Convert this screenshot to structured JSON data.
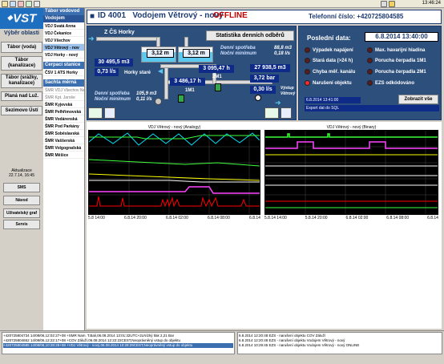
{
  "clock": "13:46:24",
  "logo": {
    "text": "VST"
  },
  "left_menu": {
    "title": "Výběr oblasti",
    "buttons": [
      "Tábor (voda)",
      "Tábor (kanalizace)",
      "Tábor (srážky, kanalizace)",
      "Planá nad Luž.",
      "Sezimovo Ústí"
    ],
    "aktualizace": "Aktualizace\n22.7.14, 16:45",
    "small_buttons": [
      "SMS",
      "Návod",
      "Uživatelský graf",
      "Servis"
    ]
  },
  "objects": {
    "group1": "Tábor vodovod",
    "group1b": "Vodojem",
    "items1": [
      "VDJ Svatá Anna",
      "VDJ Čekanice",
      "VDJ Všechov",
      "VDJ Větrový - nov",
      "VDJ Horky - nový"
    ],
    "group2": "Čerpací stanice",
    "items2": [
      "ČSV 1 ATS Horky"
    ],
    "group3": "Šachta měrná",
    "items3": [
      "ŠMR VDJ Všechov Ne",
      "ŠMR Kpt. Jaroše",
      "ŠMR Kyjevská",
      "ŠMR Pelhřimovská",
      "ŠMR Vodárenská",
      "ŠMR Pod Parkány",
      "ŠMR Soběslavská",
      "ŠMR Vaššerská",
      "ŠMR Volgogradská",
      "ŠMR Měšice"
    ]
  },
  "header": {
    "id": "ID 4001",
    "name": "Vodojem Větrový - nový",
    "status": "OFFLINE",
    "phone": "Telefonní číslo: +420725804585"
  },
  "schema": {
    "source": "Z ČS Horky",
    "stat_button": "Statistika denních odběrů",
    "tank1_level": "3,12 m",
    "tank2_level": "3,12 m",
    "spotreba_left_label": "Denní spotřeba\nNoční minimum",
    "spotreba_left_vals": "105,9 m3\n0,11 l/s",
    "spotreba_right_label": "Denní spotřeba\nNoční minimum",
    "spotreba_right_vals": "88,8 m3\n0,18 l/s",
    "v1": "30 495,5 m3",
    "v2": "0,73 l/s",
    "horky_stare": "Horky staré",
    "v3": "3 095,47 h",
    "v4": "3 486,17 h",
    "m1a": "2M1",
    "m1b": "1M1",
    "v5": "27 938,5 m3",
    "v6": "3,72 bar",
    "v7": "0,30 l/s",
    "vystup": "Výstup\nVětrový"
  },
  "right": {
    "posledni_label": "Poslední data:",
    "posledni_date": "6.8.2014 13:40:00",
    "alarms": [
      {
        "label": "Výpadek napájení",
        "active": false
      },
      {
        "label": "Max. havarijní hladina",
        "active": false
      },
      {
        "label": "Stará data (>24 h)",
        "active": false
      },
      {
        "label": "Porucha čerpadla 1M1",
        "active": false
      },
      {
        "label": "Chyba měř. kanálu",
        "active": false
      },
      {
        "label": "Porucha čerpadla 2M1",
        "active": false
      },
      {
        "label": "Narušení objektu",
        "active": true
      },
      {
        "label": "EZS odkódováno",
        "active": false
      }
    ],
    "export_date": "6.8.2014 13:41:00",
    "export_sql": "Export dat do SQL",
    "show_all": "Zobrazit vše"
  },
  "charts": {
    "analog_title": "VDJ Větrový - nový (Analogy)",
    "binary_title": "VDJ Větrový - nový (Binary)",
    "x_ticks": [
      "5.8 14:00",
      "6.8.14 20:00",
      "6.8.14 02:00",
      "6.8.14 08:00",
      "6.8.14"
    ],
    "x_ticks_bin": [
      "5.8.14 14:00",
      "5.8.14 20:00",
      "6.8.14 02:00",
      "6.8.14 08:00",
      "6.8.14"
    ],
    "y_ticks": [
      "4",
      "3",
      "2",
      "1",
      "0",
      "4",
      "3",
      "2",
      "1",
      "0"
    ],
    "colors": {
      "cyan": "#00e5ff",
      "green": "#3cff3c",
      "yellow": "#ffff00",
      "white": "#ffffff",
      "magenta": "#ff44ff",
      "red": "#ff0000"
    }
  },
  "log_left": [
    "+420725804734 14/08/06,12:02:27+08 +SMR Nam. T.Bali,06.08.2014 13:01:32UTC+2LNízký tlak 2,21 Bar",
    "+420725804652 14/08/06,12:22:17+08 +COV Záluží,06.08.2014 12:22:22CEST,Neoprávněný vstup do objektu",
    "+420725804585 14/08/06,10:28:28+08 +VDJ Větrový - nový,06.08.2014 10:28:29CEST,Neoprávněný vstup do objektu"
  ],
  "log_right": [
    "6.8.2014 12:20:48  EZS - narušení objektu COV Záluží",
    "6.8.2014 12:20:48  EZS - narušení objektu Vodojem Větrový - nový",
    "6.8.2014 10:29:45  EZS - narušení objektu Vodojem Větrový - nový ONLINE"
  ]
}
